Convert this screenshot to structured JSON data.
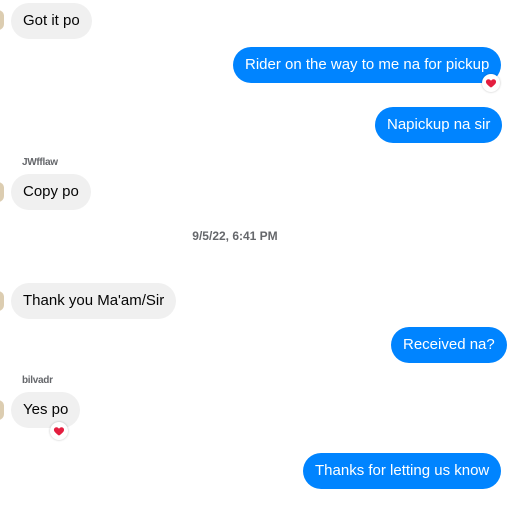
{
  "messages": [
    {
      "text": "Got it po"
    },
    {
      "text": "Rider on the way to me na for pickup"
    },
    {
      "text": "Napickup na sir"
    },
    {
      "text": "Copy po"
    },
    {
      "text": "Thank you Ma'am/Sir"
    },
    {
      "text": "Received na?"
    },
    {
      "text": "Yes po"
    },
    {
      "text": "Thanks for letting us know"
    }
  ],
  "senders": {
    "first": "JWfflaw",
    "second": "bilvadr"
  },
  "timestamp": "9/5/22, 6:41 PM",
  "colors": {
    "outgoing": "#0084ff",
    "incoming": "#f0f0f0",
    "reaction": "#e41e3f"
  }
}
